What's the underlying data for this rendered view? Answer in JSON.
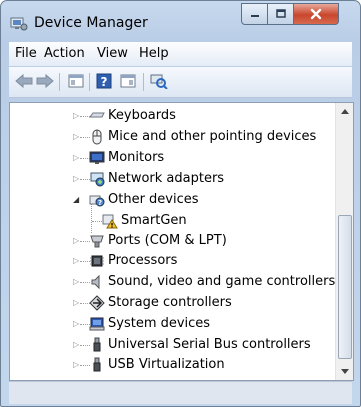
{
  "window": {
    "title": "Device Manager",
    "caption_buttons": [
      "minimize",
      "maximize",
      "close"
    ]
  },
  "menu": {
    "file": "File",
    "action": "Action",
    "view": "View",
    "help": "Help"
  },
  "toolbar": {
    "icons": [
      "back-arrow-icon",
      "forward-arrow-icon",
      "properties-icon",
      "help-icon",
      "show-hidden-icon",
      "scan-hardware-icon"
    ]
  },
  "tree": {
    "items": [
      {
        "label": "Keyboards",
        "icon": "keyboard-icon",
        "level": 1,
        "expanded": false
      },
      {
        "label": "Mice and other pointing devices",
        "icon": "mouse-icon",
        "level": 1,
        "expanded": false
      },
      {
        "label": "Monitors",
        "icon": "monitor-icon",
        "level": 1,
        "expanded": false
      },
      {
        "label": "Network adapters",
        "icon": "network-adapter-icon",
        "level": 1,
        "expanded": false
      },
      {
        "label": "Other devices",
        "icon": "unknown-device-icon",
        "level": 1,
        "expanded": true
      },
      {
        "label": "SmartGen",
        "icon": "warning-device-icon",
        "level": 2,
        "expanded": null
      },
      {
        "label": "Ports (COM & LPT)",
        "icon": "port-icon",
        "level": 1,
        "expanded": false
      },
      {
        "label": "Processors",
        "icon": "processor-icon",
        "level": 1,
        "expanded": false
      },
      {
        "label": "Sound, video and game controllers",
        "icon": "speaker-icon",
        "level": 1,
        "expanded": false
      },
      {
        "label": "Storage controllers",
        "icon": "storage-controller-icon",
        "level": 1,
        "expanded": false
      },
      {
        "label": "System devices",
        "icon": "system-device-icon",
        "level": 1,
        "expanded": false
      },
      {
        "label": "Universal Serial Bus controllers",
        "icon": "usb-icon",
        "level": 1,
        "expanded": false
      },
      {
        "label": "USB Virtualization",
        "icon": "usb-icon",
        "level": 1,
        "expanded": false
      }
    ]
  },
  "colors": {
    "title_bar": "#c2d6ec",
    "close_button": "#c9462c",
    "selection": "#3399ff",
    "warning": "#f2c12e"
  }
}
